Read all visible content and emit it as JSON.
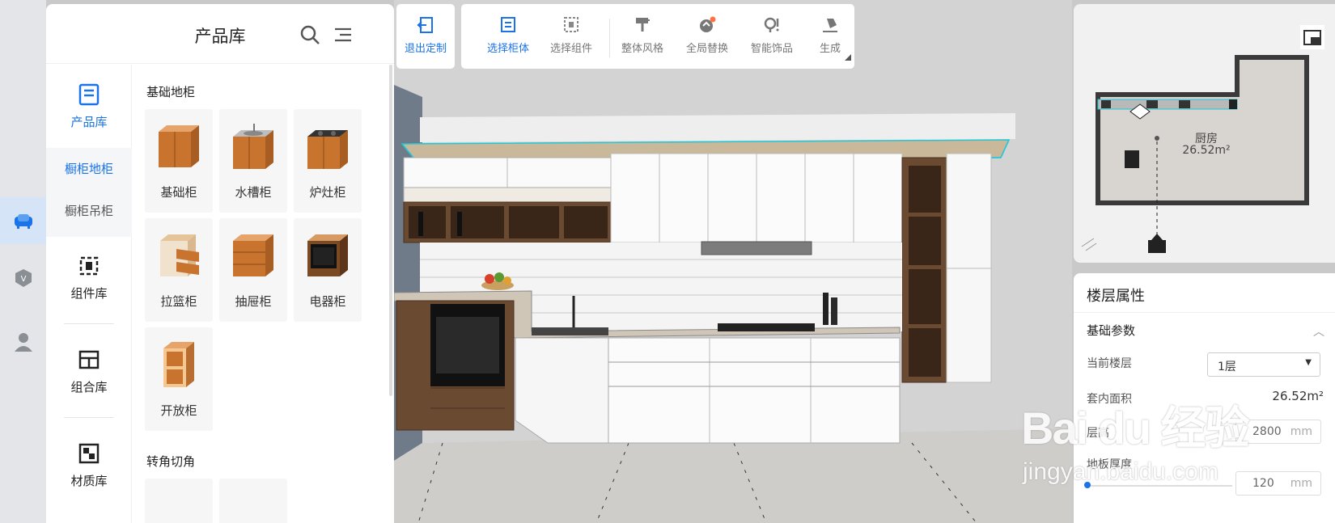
{
  "rail": {
    "items": [
      "sofa-icon",
      "badge-icon",
      "user-icon"
    ]
  },
  "library": {
    "title": "产品库",
    "nav": [
      {
        "label": "产品库",
        "icon": "book-icon",
        "active": true
      },
      {
        "label": "组件库",
        "icon": "component-icon"
      },
      {
        "label": "组合库",
        "icon": "combo-icon"
      },
      {
        "label": "材质库",
        "icon": "material-icon"
      }
    ],
    "sub_nav": [
      {
        "label": "橱柜地柜",
        "active": true
      },
      {
        "label": "橱柜吊柜"
      }
    ],
    "sections": [
      {
        "title": "基础地柜",
        "items": [
          "基础柜",
          "水槽柜",
          "炉灶柜",
          "拉篮柜",
          "抽屉柜",
          "电器柜",
          "开放柜"
        ]
      },
      {
        "title": "转角切角"
      }
    ]
  },
  "toolbar": {
    "exit": "退出定制",
    "buttons": [
      "选择柜体",
      "选择组件",
      "整体风格",
      "全局替换",
      "智能饰品",
      "生成"
    ]
  },
  "minimap": {
    "room_name": "厨房",
    "room_area": "26.52m²"
  },
  "properties": {
    "title": "楼层属性",
    "section": "基础参数",
    "floor_label": "当前楼层",
    "floor_value": "1层",
    "area_label": "套内面积",
    "area_value": "26.52m²",
    "height_label": "层高",
    "height_value": "2800",
    "height_unit": "mm",
    "thickness_label": "地板厚度",
    "thickness_value": "120",
    "thickness_unit": "mm"
  },
  "watermark": {
    "line1": "Bai du 经验",
    "line2": "jingyan.baidu.com"
  },
  "colors": {
    "accent": "#1a73e8",
    "selection": "#20c8d8"
  }
}
